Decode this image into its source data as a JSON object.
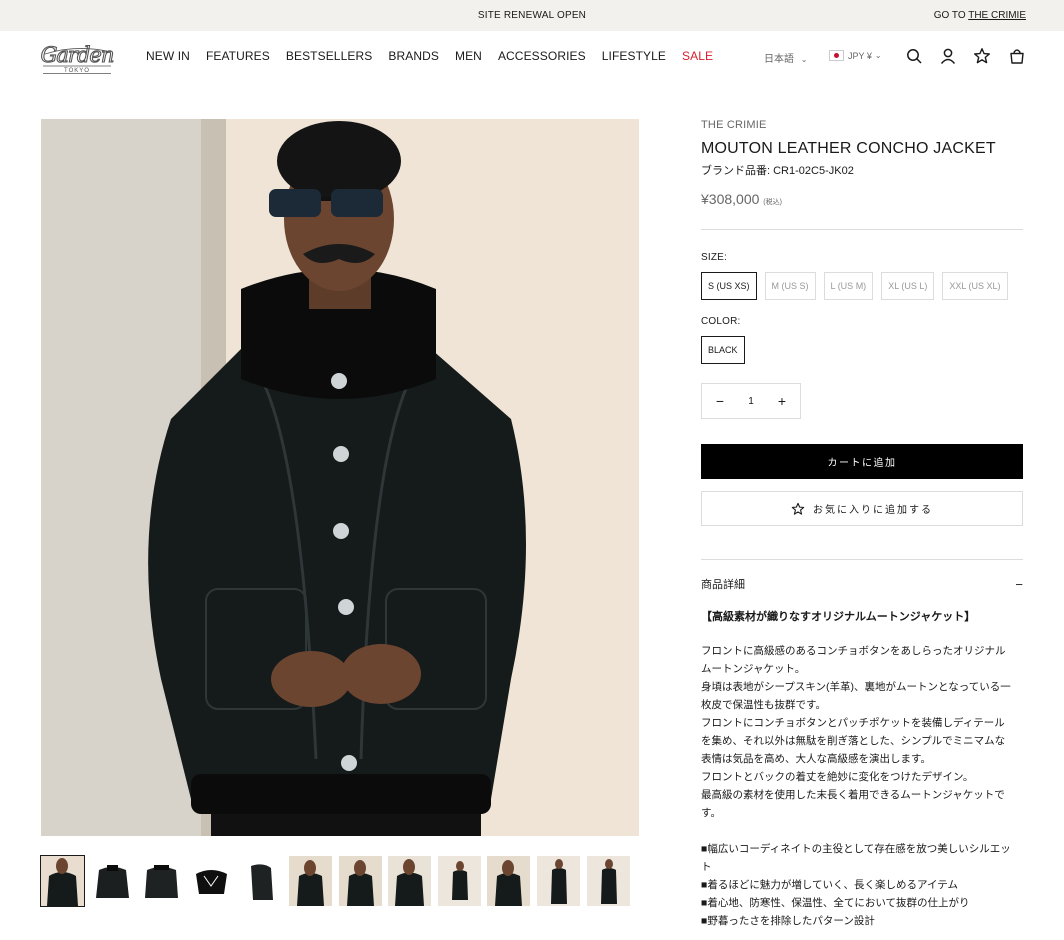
{
  "announcement": {
    "text": "SITE RENEWAL OPEN",
    "goto_prefix": "GO TO ",
    "goto_brand": "THE CRIMIE"
  },
  "header": {
    "logo_text": "Garden",
    "logo_sub": "TOKYO",
    "nav": [
      "NEW IN",
      "FEATURES",
      "BESTSELLERS",
      "BRANDS",
      "MEN",
      "ACCESSORIES",
      "LIFESTYLE",
      "SALE"
    ],
    "language": "日本語",
    "currency": "JPY ¥",
    "icons": [
      "search-icon",
      "account-icon",
      "star-icon",
      "bag-icon"
    ]
  },
  "product": {
    "vendor": "THE CRIMIE",
    "title": "MOUTON LEATHER CONCHO JACKET",
    "sku": "ブランド品番: CR1-02C5-JK02",
    "price": "¥308,000",
    "price_note": "(税込)",
    "size_label": "SIZE:",
    "sizes": [
      "S (US XS)",
      "M (US S)",
      "L (US M)",
      "XL (US L)",
      "XXL (US XL)"
    ],
    "selected_size": "S (US XS)",
    "color_label": "COLOR:",
    "colors": [
      "BLACK"
    ],
    "quantity": "1",
    "add_to_cart": "カートに追加",
    "add_to_wishlist": "お気に入りに追加する",
    "details_label": "商品詳細",
    "details_toggle": "−",
    "desc_heading": "【高級素材が織りなすオリジナルムートンジャケット】",
    "description": [
      "フロントに高級感のあるコンチョボタンをあしらったオリジナルムートンジャケット。",
      "身頃は表地がシープスキン(羊革)、裏地がムートンとなっている一枚皮で保温性も抜群です。",
      "フロントにコンチョボタンとパッチポケットを装備しディテールを集め、それ以外は無駄を削ぎ落とした、シンプルでミニマムな表情は気品を高め、大人な高級感を演出します。",
      "フロントとバックの着丈を絶妙に変化をつけたデザイン。",
      "最高級の素材を使用した末長く着用できるムートンジャケットです。"
    ],
    "bullets": [
      "■幅広いコーディネイトの主役として存在感を放つ美しいシルエット",
      "■着るほどに魅力が増していく、長く楽しめるアイテム",
      "■着心地、防寒性、保温性、全てにおいて抜群の仕上がり",
      "■野暮ったさを排除したパターン設計"
    ],
    "thumbnail_count": 12
  },
  "colors": {
    "sale": "#d6202f",
    "announce_bg": "#f3f1ed",
    "cart_bg": "#000000",
    "border": "#dcdcdc"
  }
}
